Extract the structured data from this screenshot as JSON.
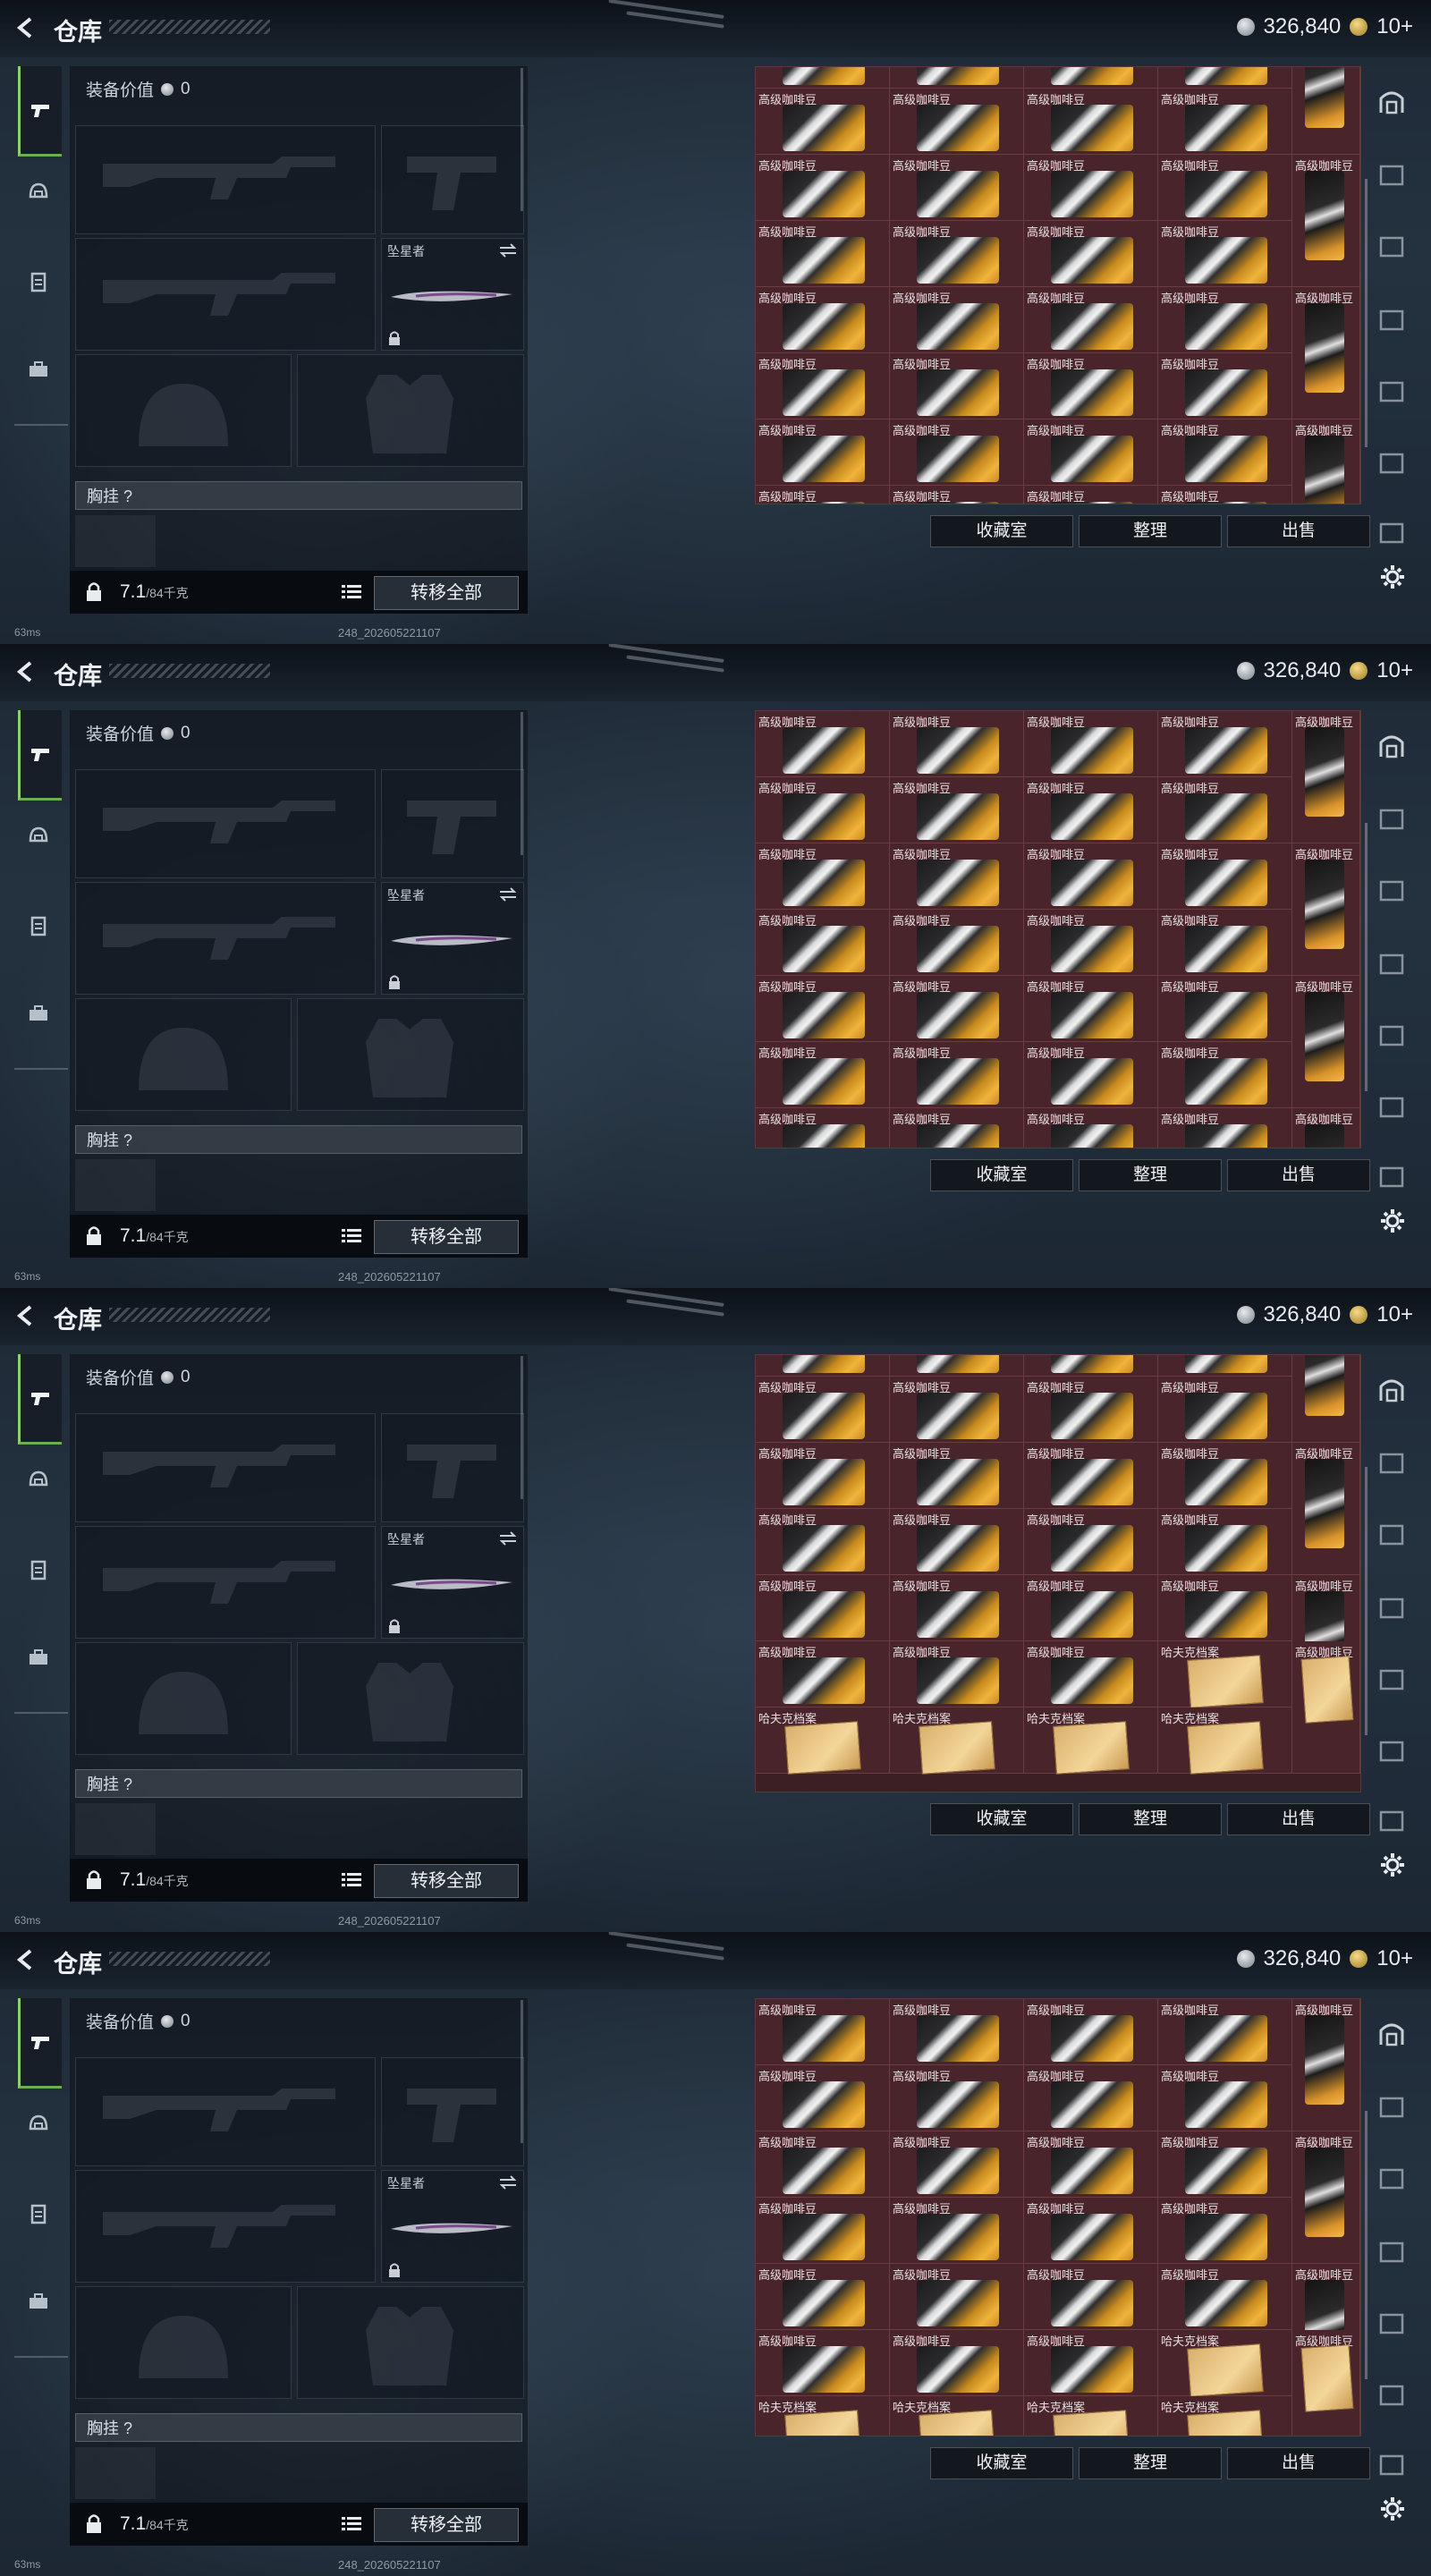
{
  "page": {
    "title": "仓库",
    "currency": {
      "silver": "326,840",
      "gold": "10+"
    },
    "equip_value_label": "装备价值",
    "equip_value": "0",
    "knife_label": "坠星者",
    "chest_label": "胸挂  ?",
    "weight_value": "7.1",
    "weight_cap": "/84千克",
    "transfer_all": "转移全部",
    "collection_room": "收藏室",
    "organize": "整理",
    "sell": "出售",
    "status_text": "63ms",
    "build_text": "248_202605221107",
    "item_names": {
      "coffee": "高级咖啡豆",
      "file": "哈夫克档案"
    }
  },
  "colors": {
    "inventory_bg": "#4a242b",
    "accent_green": "#8ccf6c"
  },
  "icons": [
    "back-arrow-icon",
    "pistol-tab-icon",
    "helmet-tab-icon",
    "clipboard-tab-icon",
    "toolbox-tab-icon",
    "settings-gear-icon",
    "vault-icon",
    "list-icon",
    "lock-icon",
    "swap-icon"
  ],
  "frames": [
    {
      "layout": "coffee"
    },
    {
      "layout": "coffee"
    },
    {
      "layout": "mixed"
    },
    {
      "layout": "mixed"
    }
  ]
}
